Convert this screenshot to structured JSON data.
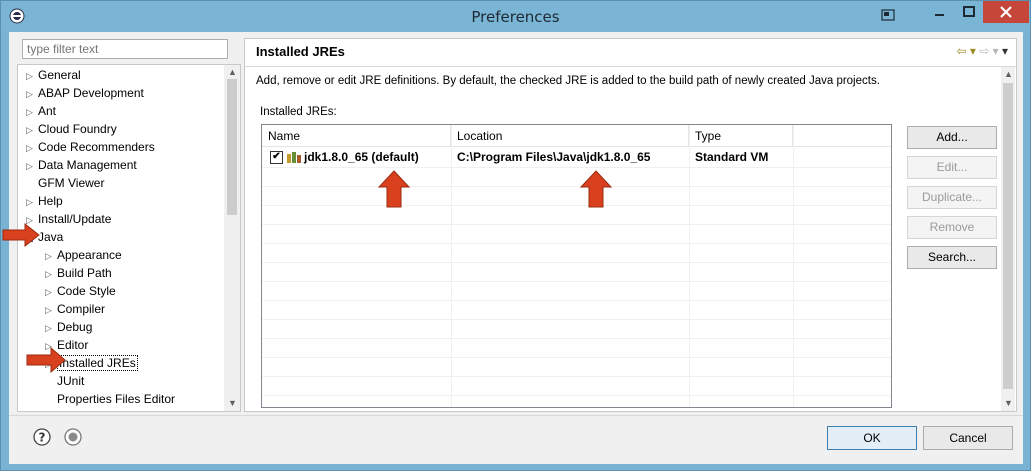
{
  "window": {
    "title": "Preferences"
  },
  "filter": {
    "placeholder": "type filter text"
  },
  "tree": {
    "items": [
      {
        "label": "General",
        "level": 0,
        "twisty": "▷"
      },
      {
        "label": "ABAP Development",
        "level": 0,
        "twisty": "▷"
      },
      {
        "label": "Ant",
        "level": 0,
        "twisty": "▷"
      },
      {
        "label": "Cloud Foundry",
        "level": 0,
        "twisty": "▷"
      },
      {
        "label": "Code Recommenders",
        "level": 0,
        "twisty": "▷"
      },
      {
        "label": "Data Management",
        "level": 0,
        "twisty": "▷"
      },
      {
        "label": "GFM Viewer",
        "level": 0,
        "twisty": ""
      },
      {
        "label": "Help",
        "level": 0,
        "twisty": "▷"
      },
      {
        "label": "Install/Update",
        "level": 0,
        "twisty": "▷"
      },
      {
        "label": "Java",
        "level": 0,
        "twisty": "◢"
      },
      {
        "label": "Appearance",
        "level": 1,
        "twisty": "▷"
      },
      {
        "label": "Build Path",
        "level": 1,
        "twisty": "▷"
      },
      {
        "label": "Code Style",
        "level": 1,
        "twisty": "▷"
      },
      {
        "label": "Compiler",
        "level": 1,
        "twisty": "▷"
      },
      {
        "label": "Debug",
        "level": 1,
        "twisty": "▷"
      },
      {
        "label": "Editor",
        "level": 1,
        "twisty": "▷"
      },
      {
        "label": "Installed JREs",
        "level": 1,
        "twisty": "▷"
      },
      {
        "label": "JUnit",
        "level": 1,
        "twisty": ""
      },
      {
        "label": "Properties Files Editor",
        "level": 1,
        "twisty": ""
      }
    ]
  },
  "page": {
    "title": "Installed JREs",
    "description": "Add, remove or edit JRE definitions. By default, the checked JRE is added to the build path of newly created Java projects.",
    "table_label": "Installed JREs:"
  },
  "table": {
    "columns": [
      "Name",
      "Location",
      "Type"
    ],
    "rows": [
      {
        "name": "jdk1.8.0_65 (default)",
        "location": "C:\\Program Files\\Java\\jdk1.8.0_65",
        "type": "Standard VM",
        "checked": "✔"
      }
    ]
  },
  "buttons": {
    "add": "Add...",
    "edit": "Edit...",
    "duplicate": "Duplicate...",
    "remove": "Remove",
    "search": "Search...",
    "ok": "OK",
    "cancel": "Cancel"
  },
  "nav": {
    "back": "⇦ ▾",
    "forward": "⇨ ▾",
    "menu": "▾"
  },
  "colors": {
    "titlebar": "#7ab5d6",
    "close_button": "#c7463a",
    "arrow": "#d9411e"
  }
}
